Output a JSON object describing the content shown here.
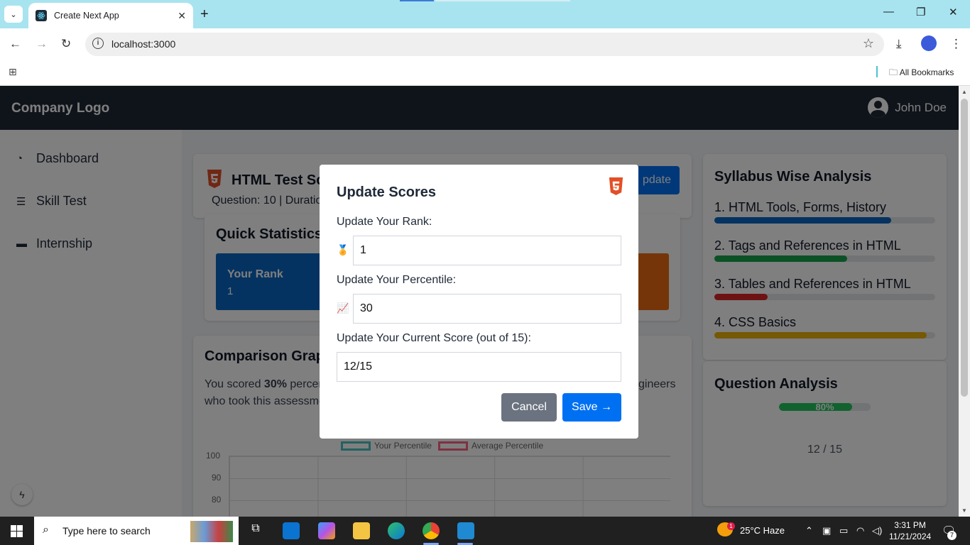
{
  "browser": {
    "tab_title": "Create Next App",
    "url": "localhost:3000",
    "bookmarks_label": "All Bookmarks"
  },
  "app": {
    "logo": "Company Logo",
    "user_name": "John Doe",
    "sidebar": [
      {
        "label": "Dashboard",
        "icon": "dashboard-icon"
      },
      {
        "label": "Skill Test",
        "icon": "list-icon"
      },
      {
        "label": "Internship",
        "icon": "briefcase-icon"
      }
    ],
    "test": {
      "title": "HTML Test Sc",
      "meta": "Question: 10 | Duratio",
      "update_button": "pdate"
    },
    "quick_stats": {
      "title": "Quick Statistics",
      "rank_label": "Your Rank",
      "rank_value": "1"
    },
    "comparison": {
      "title": "Comparison Grap",
      "text_prefix": "You scored ",
      "text_bold": "30%",
      "text_suffix": " percen",
      "text_line2": "who took this assessme",
      "text_right": "gineers",
      "legend": [
        "Your Percentile",
        "Average Percentile"
      ],
      "legend_colors": [
        "#4bc0c0",
        "#ff6384"
      ],
      "y_ticks": [
        "100",
        "90",
        "80"
      ]
    },
    "syllabus": {
      "title": "Syllabus Wise Analysis",
      "items": [
        {
          "label": "1. HTML Tools, Forms, History",
          "percent": 80,
          "color": "#0a66c2"
        },
        {
          "label": "2. Tags and References in HTML",
          "percent": 60,
          "color": "#16a34a"
        },
        {
          "label": "3. Tables and References in HTML",
          "percent": 24,
          "color": "#dc2626"
        },
        {
          "label": "4. CSS Basics",
          "percent": 96,
          "color": "#eab308"
        }
      ]
    },
    "question_analysis": {
      "title": "Question Analysis",
      "progress_label": "80%",
      "progress": 80,
      "score": "12 / 15"
    }
  },
  "modal": {
    "title": "Update Scores",
    "rank_label": "Update Your Rank:",
    "rank_value": "1",
    "percentile_label": "Update Your Percentile:",
    "percentile_value": "30",
    "score_label": "Update Your Current Score (out of 15):",
    "score_value": "12/15",
    "cancel": "Cancel",
    "save": "Save →"
  },
  "taskbar": {
    "search_placeholder": "Type here to search",
    "weather": "25°C  Haze",
    "weather_badge": "1",
    "time": "3:31 PM",
    "date": "11/21/2024",
    "notification_count": "7"
  }
}
